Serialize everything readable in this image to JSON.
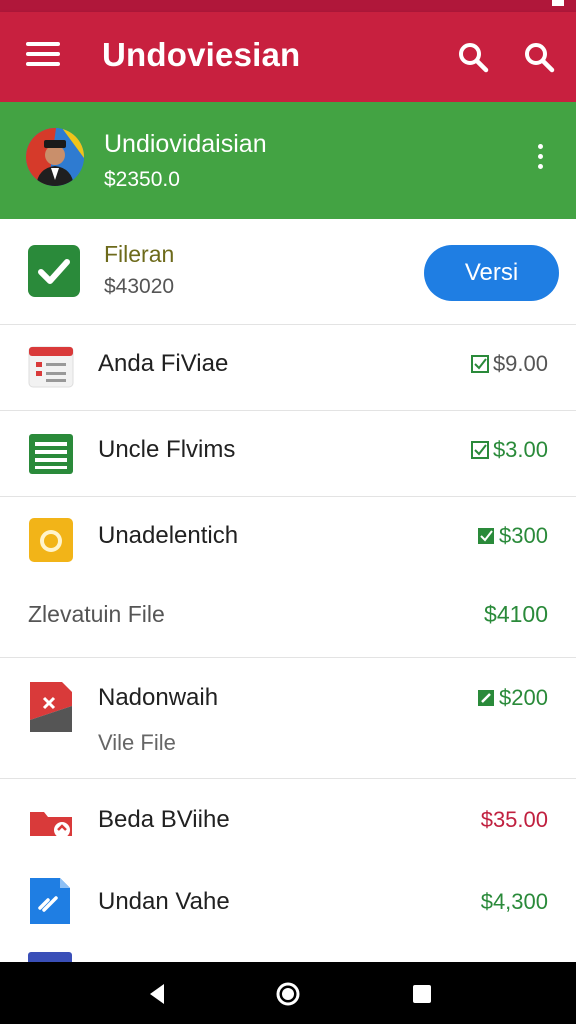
{
  "app_bar": {
    "title": "Undoviesian",
    "menu_icon": "menu-icon",
    "search_icons": [
      "search-icon",
      "search-icon"
    ]
  },
  "profile": {
    "name": "Undiovidaisian",
    "amount": "$2350.0",
    "more_icon": "more-vert-icon"
  },
  "summary": {
    "label": "Fileran",
    "amount": "$43020",
    "button_label": "Versi"
  },
  "rows": [
    {
      "title": "Anda FiViae",
      "amount": "$9.00",
      "icon": "form-icon",
      "amount_color": "#2a8a3a"
    },
    {
      "title": "Uncle Flvims",
      "amount": "$3.00",
      "icon": "sheet-icon",
      "amount_color": "#2a8a3a"
    },
    {
      "title": "Unadelentich",
      "amount": "$300",
      "icon": "coin-icon",
      "amount_color": "#2a8a3a"
    }
  ],
  "section": {
    "label": "Zlevatuin File",
    "amount": "$4100"
  },
  "file_row": {
    "title": "Nadonwaih",
    "subtitle": "Vile File",
    "amount": "$200"
  },
  "bottom_rows": [
    {
      "title": "Beda BViihe",
      "amount": "$35.00",
      "icon": "folder-icon",
      "amount_color": "#c0203f"
    },
    {
      "title": "Undan Vahe",
      "amount": "$4,300",
      "icon": "document-icon",
      "amount_color": "#2a8a3a"
    }
  ],
  "colors": {
    "app_bar": "#c8203f",
    "profile_bg": "#43a343",
    "accent_blue": "#1f7ee3",
    "positive": "#2a8a3a",
    "negative": "#c0203f"
  }
}
